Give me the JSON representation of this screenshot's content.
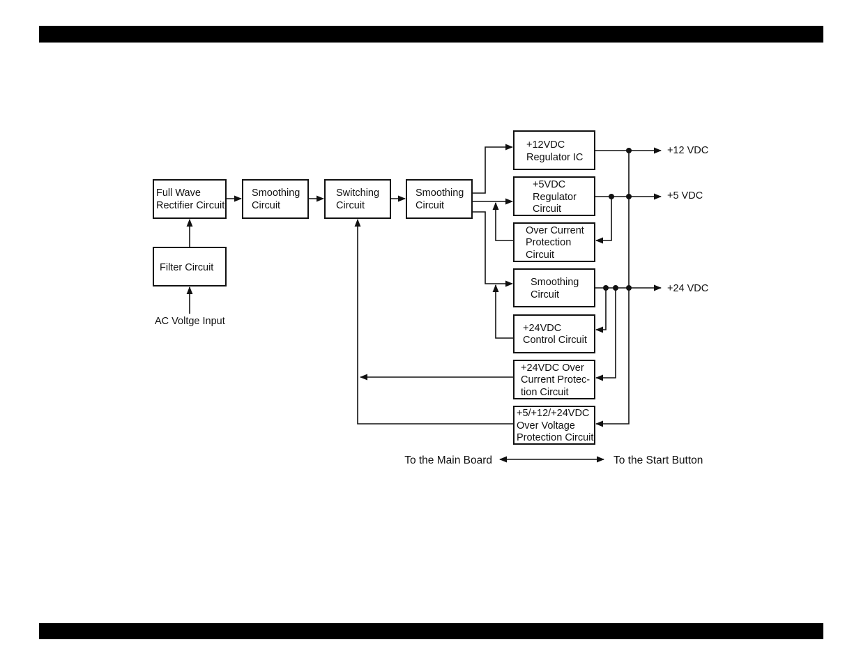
{
  "blocks": {
    "full_wave": [
      "Full Wave",
      "Rectifier Circuit"
    ],
    "filter": [
      "Filter Circuit"
    ],
    "smoothing1": [
      "Smoothing",
      "Circuit"
    ],
    "switching": [
      "Switching",
      "Circuit"
    ],
    "smoothing2": [
      "Smoothing",
      "Circuit"
    ],
    "reg12": [
      "+12VDC",
      "Regulator IC"
    ],
    "reg5": [
      "+5VDC",
      "Regulator",
      "Circuit"
    ],
    "ocp": [
      "Over Current",
      "Protection",
      "Circuit"
    ],
    "smoothing3": [
      "Smoothing",
      "Circuit"
    ],
    "ctrl24": [
      "+24VDC",
      "Control Circuit"
    ],
    "ocp24": [
      "+24VDC Over",
      "Current Protec-",
      "tion Circuit"
    ],
    "ovp": [
      "+5/+12/+24VDC",
      "Over Voltage",
      "Protection Circuit"
    ]
  },
  "labels": {
    "ac_input": "AC Voltge Input",
    "out12": "+12 VDC",
    "out5": "+5 VDC",
    "out24": "+24 VDC",
    "main_board": "To the Main Board",
    "start_button": "To the Start Button"
  }
}
